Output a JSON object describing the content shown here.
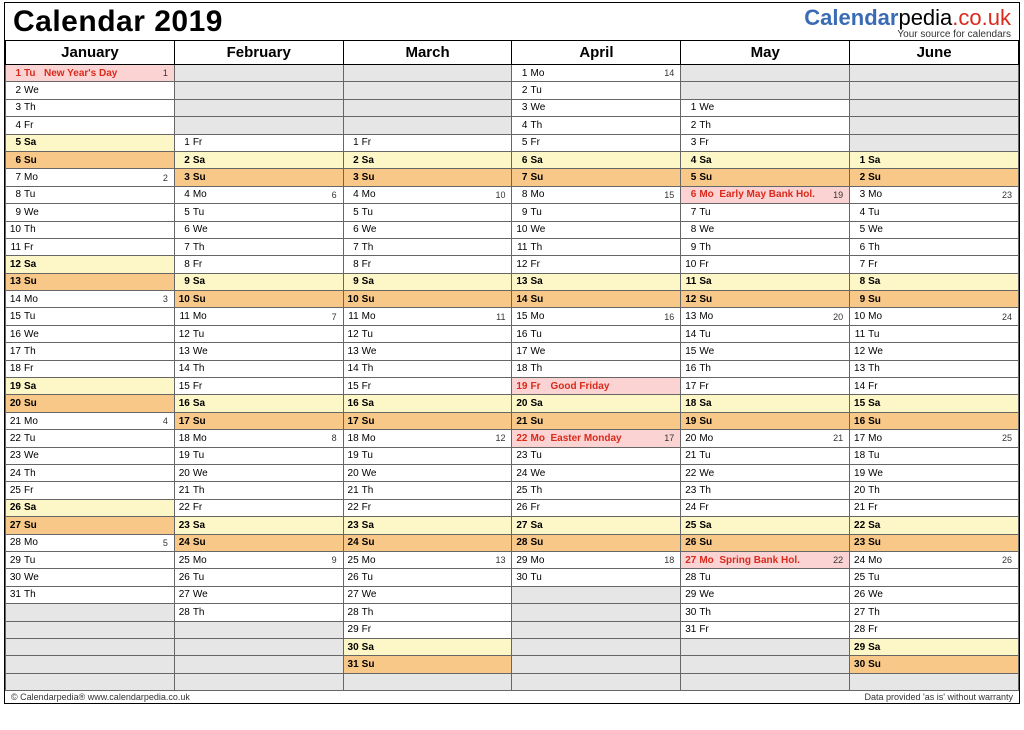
{
  "title": "Calendar 2019",
  "brand": {
    "a": "Calendar",
    "b": "pedia",
    "tld": ".co.uk",
    "sub": "Your source for calendars"
  },
  "footer": {
    "left": "© Calendarpedia®   www.calendarpedia.co.uk",
    "right": "Data provided 'as is' without warranty"
  },
  "maxRows": 36,
  "months": [
    {
      "name": "January",
      "offset": 0,
      "days": [
        {
          "d": 1,
          "w": "Tu",
          "hol": "New Year's Day",
          "wk": 1
        },
        {
          "d": 2,
          "w": "We"
        },
        {
          "d": 3,
          "w": "Th"
        },
        {
          "d": 4,
          "w": "Fr"
        },
        {
          "d": 5,
          "w": "Sa"
        },
        {
          "d": 6,
          "w": "Su"
        },
        {
          "d": 7,
          "w": "Mo",
          "wk": 2
        },
        {
          "d": 8,
          "w": "Tu"
        },
        {
          "d": 9,
          "w": "We"
        },
        {
          "d": 10,
          "w": "Th"
        },
        {
          "d": 11,
          "w": "Fr"
        },
        {
          "d": 12,
          "w": "Sa"
        },
        {
          "d": 13,
          "w": "Su"
        },
        {
          "d": 14,
          "w": "Mo",
          "wk": 3
        },
        {
          "d": 15,
          "w": "Tu"
        },
        {
          "d": 16,
          "w": "We"
        },
        {
          "d": 17,
          "w": "Th"
        },
        {
          "d": 18,
          "w": "Fr"
        },
        {
          "d": 19,
          "w": "Sa"
        },
        {
          "d": 20,
          "w": "Su"
        },
        {
          "d": 21,
          "w": "Mo",
          "wk": 4
        },
        {
          "d": 22,
          "w": "Tu"
        },
        {
          "d": 23,
          "w": "We"
        },
        {
          "d": 24,
          "w": "Th"
        },
        {
          "d": 25,
          "w": "Fr"
        },
        {
          "d": 26,
          "w": "Sa"
        },
        {
          "d": 27,
          "w": "Su"
        },
        {
          "d": 28,
          "w": "Mo",
          "wk": 5
        },
        {
          "d": 29,
          "w": "Tu"
        },
        {
          "d": 30,
          "w": "We"
        },
        {
          "d": 31,
          "w": "Th"
        }
      ]
    },
    {
      "name": "February",
      "offset": 4,
      "days": [
        {
          "d": 1,
          "w": "Fr"
        },
        {
          "d": 2,
          "w": "Sa"
        },
        {
          "d": 3,
          "w": "Su"
        },
        {
          "d": 4,
          "w": "Mo",
          "wk": 6
        },
        {
          "d": 5,
          "w": "Tu"
        },
        {
          "d": 6,
          "w": "We"
        },
        {
          "d": 7,
          "w": "Th"
        },
        {
          "d": 8,
          "w": "Fr"
        },
        {
          "d": 9,
          "w": "Sa"
        },
        {
          "d": 10,
          "w": "Su"
        },
        {
          "d": 11,
          "w": "Mo",
          "wk": 7
        },
        {
          "d": 12,
          "w": "Tu"
        },
        {
          "d": 13,
          "w": "We"
        },
        {
          "d": 14,
          "w": "Th"
        },
        {
          "d": 15,
          "w": "Fr"
        },
        {
          "d": 16,
          "w": "Sa"
        },
        {
          "d": 17,
          "w": "Su"
        },
        {
          "d": 18,
          "w": "Mo",
          "wk": 8
        },
        {
          "d": 19,
          "w": "Tu"
        },
        {
          "d": 20,
          "w": "We"
        },
        {
          "d": 21,
          "w": "Th"
        },
        {
          "d": 22,
          "w": "Fr"
        },
        {
          "d": 23,
          "w": "Sa"
        },
        {
          "d": 24,
          "w": "Su"
        },
        {
          "d": 25,
          "w": "Mo",
          "wk": 9
        },
        {
          "d": 26,
          "w": "Tu"
        },
        {
          "d": 27,
          "w": "We"
        },
        {
          "d": 28,
          "w": "Th"
        }
      ]
    },
    {
      "name": "March",
      "offset": 4,
      "days": [
        {
          "d": 1,
          "w": "Fr"
        },
        {
          "d": 2,
          "w": "Sa"
        },
        {
          "d": 3,
          "w": "Su"
        },
        {
          "d": 4,
          "w": "Mo",
          "wk": 10
        },
        {
          "d": 5,
          "w": "Tu"
        },
        {
          "d": 6,
          "w": "We"
        },
        {
          "d": 7,
          "w": "Th"
        },
        {
          "d": 8,
          "w": "Fr"
        },
        {
          "d": 9,
          "w": "Sa"
        },
        {
          "d": 10,
          "w": "Su"
        },
        {
          "d": 11,
          "w": "Mo",
          "wk": 11
        },
        {
          "d": 12,
          "w": "Tu"
        },
        {
          "d": 13,
          "w": "We"
        },
        {
          "d": 14,
          "w": "Th"
        },
        {
          "d": 15,
          "w": "Fr"
        },
        {
          "d": 16,
          "w": "Sa"
        },
        {
          "d": 17,
          "w": "Su"
        },
        {
          "d": 18,
          "w": "Mo",
          "wk": 12
        },
        {
          "d": 19,
          "w": "Tu"
        },
        {
          "d": 20,
          "w": "We"
        },
        {
          "d": 21,
          "w": "Th"
        },
        {
          "d": 22,
          "w": "Fr"
        },
        {
          "d": 23,
          "w": "Sa"
        },
        {
          "d": 24,
          "w": "Su"
        },
        {
          "d": 25,
          "w": "Mo",
          "wk": 13
        },
        {
          "d": 26,
          "w": "Tu"
        },
        {
          "d": 27,
          "w": "We"
        },
        {
          "d": 28,
          "w": "Th"
        },
        {
          "d": 29,
          "w": "Fr"
        },
        {
          "d": 30,
          "w": "Sa"
        },
        {
          "d": 31,
          "w": "Su"
        }
      ]
    },
    {
      "name": "April",
      "offset": 0,
      "days": [
        {
          "d": 1,
          "w": "Mo",
          "wk": 14
        },
        {
          "d": 2,
          "w": "Tu"
        },
        {
          "d": 3,
          "w": "We"
        },
        {
          "d": 4,
          "w": "Th"
        },
        {
          "d": 5,
          "w": "Fr"
        },
        {
          "d": 6,
          "w": "Sa"
        },
        {
          "d": 7,
          "w": "Su"
        },
        {
          "d": 8,
          "w": "Mo",
          "wk": 15
        },
        {
          "d": 9,
          "w": "Tu"
        },
        {
          "d": 10,
          "w": "We"
        },
        {
          "d": 11,
          "w": "Th"
        },
        {
          "d": 12,
          "w": "Fr"
        },
        {
          "d": 13,
          "w": "Sa"
        },
        {
          "d": 14,
          "w": "Su"
        },
        {
          "d": 15,
          "w": "Mo",
          "wk": 16
        },
        {
          "d": 16,
          "w": "Tu"
        },
        {
          "d": 17,
          "w": "We"
        },
        {
          "d": 18,
          "w": "Th"
        },
        {
          "d": 19,
          "w": "Fr",
          "hol": "Good Friday"
        },
        {
          "d": 20,
          "w": "Sa"
        },
        {
          "d": 21,
          "w": "Su"
        },
        {
          "d": 22,
          "w": "Mo",
          "hol": "Easter Monday",
          "wk": 17
        },
        {
          "d": 23,
          "w": "Tu"
        },
        {
          "d": 24,
          "w": "We"
        },
        {
          "d": 25,
          "w": "Th"
        },
        {
          "d": 26,
          "w": "Fr"
        },
        {
          "d": 27,
          "w": "Sa"
        },
        {
          "d": 28,
          "w": "Su"
        },
        {
          "d": 29,
          "w": "Mo",
          "wk": 18
        },
        {
          "d": 30,
          "w": "Tu"
        }
      ]
    },
    {
      "name": "May",
      "offset": 2,
      "days": [
        {
          "d": 1,
          "w": "We"
        },
        {
          "d": 2,
          "w": "Th"
        },
        {
          "d": 3,
          "w": "Fr"
        },
        {
          "d": 4,
          "w": "Sa"
        },
        {
          "d": 5,
          "w": "Su"
        },
        {
          "d": 6,
          "w": "Mo",
          "hol": "Early May Bank Hol.",
          "wk": 19
        },
        {
          "d": 7,
          "w": "Tu"
        },
        {
          "d": 8,
          "w": "We"
        },
        {
          "d": 9,
          "w": "Th"
        },
        {
          "d": 10,
          "w": "Fr"
        },
        {
          "d": 11,
          "w": "Sa"
        },
        {
          "d": 12,
          "w": "Su"
        },
        {
          "d": 13,
          "w": "Mo",
          "wk": 20
        },
        {
          "d": 14,
          "w": "Tu"
        },
        {
          "d": 15,
          "w": "We"
        },
        {
          "d": 16,
          "w": "Th"
        },
        {
          "d": 17,
          "w": "Fr"
        },
        {
          "d": 18,
          "w": "Sa"
        },
        {
          "d": 19,
          "w": "Su"
        },
        {
          "d": 20,
          "w": "Mo",
          "wk": 21
        },
        {
          "d": 21,
          "w": "Tu"
        },
        {
          "d": 22,
          "w": "We"
        },
        {
          "d": 23,
          "w": "Th"
        },
        {
          "d": 24,
          "w": "Fr"
        },
        {
          "d": 25,
          "w": "Sa"
        },
        {
          "d": 26,
          "w": "Su"
        },
        {
          "d": 27,
          "w": "Mo",
          "hol": "Spring Bank Hol.",
          "wk": 22
        },
        {
          "d": 28,
          "w": "Tu"
        },
        {
          "d": 29,
          "w": "We"
        },
        {
          "d": 30,
          "w": "Th"
        },
        {
          "d": 31,
          "w": "Fr"
        }
      ]
    },
    {
      "name": "June",
      "offset": 5,
      "days": [
        {
          "d": 1,
          "w": "Sa"
        },
        {
          "d": 2,
          "w": "Su"
        },
        {
          "d": 3,
          "w": "Mo",
          "wk": 23
        },
        {
          "d": 4,
          "w": "Tu"
        },
        {
          "d": 5,
          "w": "We"
        },
        {
          "d": 6,
          "w": "Th"
        },
        {
          "d": 7,
          "w": "Fr"
        },
        {
          "d": 8,
          "w": "Sa"
        },
        {
          "d": 9,
          "w": "Su"
        },
        {
          "d": 10,
          "w": "Mo",
          "wk": 24
        },
        {
          "d": 11,
          "w": "Tu"
        },
        {
          "d": 12,
          "w": "We"
        },
        {
          "d": 13,
          "w": "Th"
        },
        {
          "d": 14,
          "w": "Fr"
        },
        {
          "d": 15,
          "w": "Sa"
        },
        {
          "d": 16,
          "w": "Su"
        },
        {
          "d": 17,
          "w": "Mo",
          "wk": 25
        },
        {
          "d": 18,
          "w": "Tu"
        },
        {
          "d": 19,
          "w": "We"
        },
        {
          "d": 20,
          "w": "Th"
        },
        {
          "d": 21,
          "w": "Fr"
        },
        {
          "d": 22,
          "w": "Sa"
        },
        {
          "d": 23,
          "w": "Su"
        },
        {
          "d": 24,
          "w": "Mo",
          "wk": 26
        },
        {
          "d": 25,
          "w": "Tu"
        },
        {
          "d": 26,
          "w": "We"
        },
        {
          "d": 27,
          "w": "Th"
        },
        {
          "d": 28,
          "w": "Fr"
        },
        {
          "d": 29,
          "w": "Sa"
        },
        {
          "d": 30,
          "w": "Su"
        }
      ]
    }
  ]
}
